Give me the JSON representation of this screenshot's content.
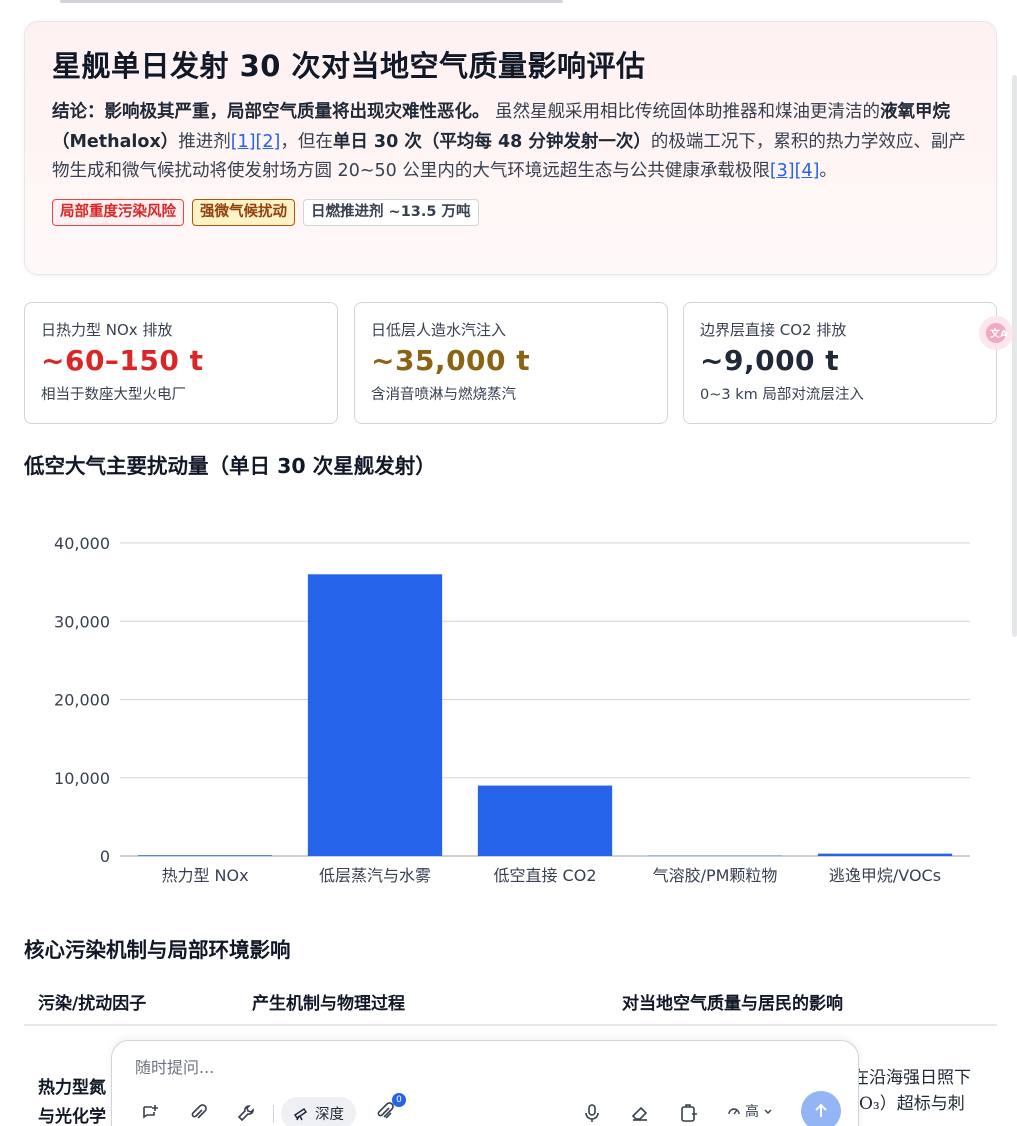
{
  "summary": {
    "title": "星舰单日发射 30 次对当地空气质量影响评估",
    "conclusion_label": "结论：影响极其严重，局部空气质量将出现灾难性恶化。",
    "body_part1": " 虽然星舰采用相比传统固体助推器和煤油更清洁的",
    "body_bold1": "液氧甲烷（Methalox）",
    "body_part2": "推进剂",
    "ref1": "[1]",
    "ref2": "[2]",
    "body_part3": "，但在",
    "body_bold2": "单日 30 次（平均每 48 分钟发射一次）",
    "body_part4": "的极端工况下，累积的热力学效应、副产物生成和微气候扰动将使发射场方圆 20~50 公里内的大气环境远超生态与公共健康承载极限",
    "ref3": "[3]",
    "ref4": "[4]",
    "body_end": "。",
    "tags": [
      "局部重度污染风险",
      "强微气候扰动",
      "日燃推进剂 ~13.5 万吨"
    ]
  },
  "stats": [
    {
      "label": "日热力型 NOx 排放",
      "value": "~60–150 t",
      "note": "相当于数座大型火电厂",
      "color": "#dc2626"
    },
    {
      "label": "日低层人造水汽注入",
      "value": "~35,000 t",
      "note": "含消音喷淋与燃烧蒸汽",
      "color": "#8a6412"
    },
    {
      "label": "边界层直接 CO2 排放",
      "value": "~9,000 t",
      "note": "0~3 km 局部对流层注入",
      "color": "#1f2937"
    }
  ],
  "chart_section_title": "低空大气主要扰动量（单日 30 次星舰发射）",
  "chart_data": {
    "type": "bar",
    "title": "",
    "categories": [
      "热力型 NOx",
      "低层蒸汽与水雾",
      "低空直接 CO2",
      "气溶胶/PM颗粒物",
      "逃逸甲烷/VOCs"
    ],
    "values": [
      100,
      36000,
      9000,
      50,
      300
    ],
    "ylim": [
      0,
      40000
    ],
    "yticks": [
      "0",
      "10,000",
      "20,000",
      "30,000",
      "40,000"
    ],
    "ytick_values": [
      0,
      10000,
      20000,
      30000,
      40000
    ],
    "bar_color": "#2563eb",
    "grid": true
  },
  "table_section_title": "核心污染机制与局部环境影响",
  "table": {
    "headers": [
      "污染/扰动因子",
      "产生机制与物理过程",
      "对当地空气质量与居民的影响"
    ],
    "row1_left_line1": "热力型氮",
    "row1_left_line2": "与光化学",
    "row1_right_line1": "在沿海强日照下",
    "row1_right_line2": "O₃）超标与刺"
  },
  "input": {
    "placeholder": "随时提问...",
    "deep_label": "深度",
    "attach_count": "0",
    "level_label": "高"
  }
}
